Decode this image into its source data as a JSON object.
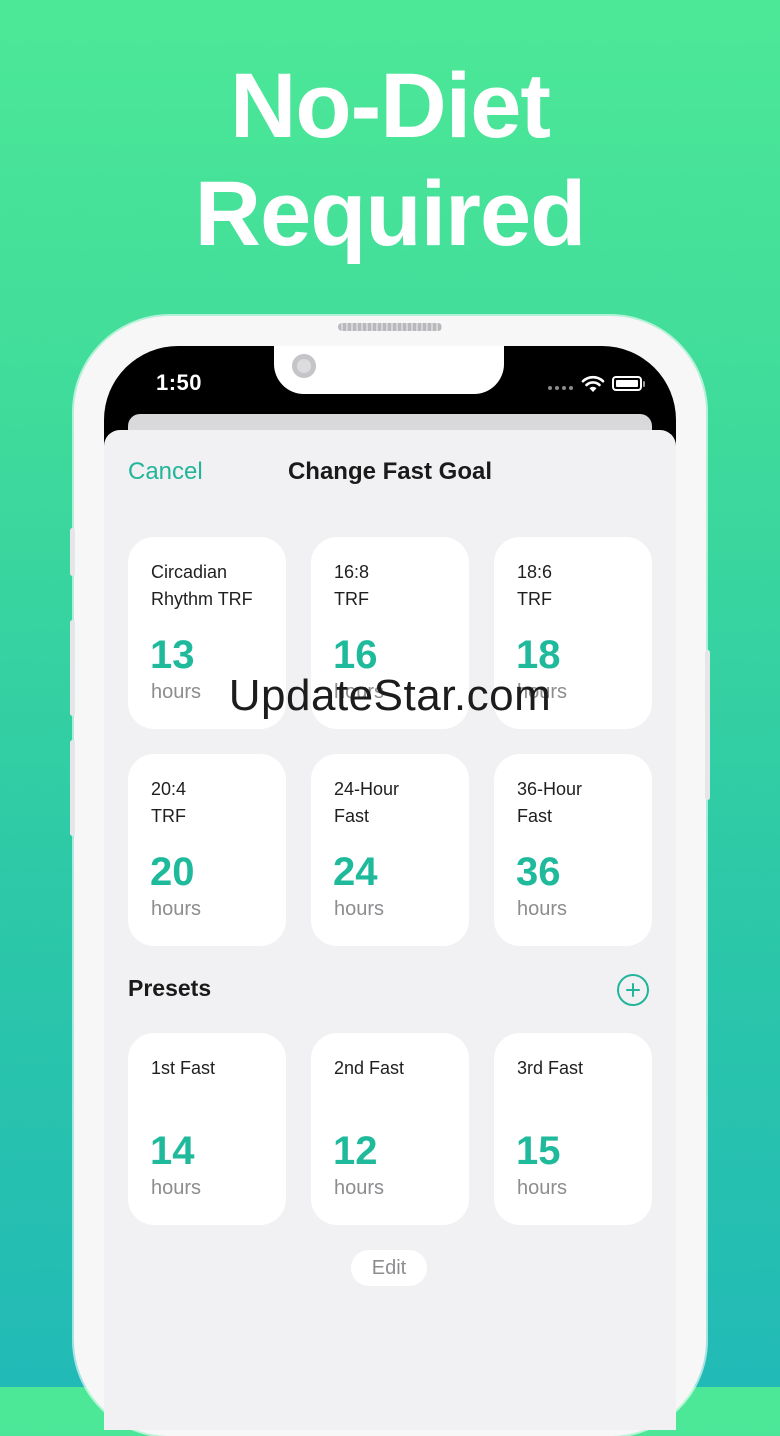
{
  "headline": {
    "line1": "No-Diet",
    "line2": "Required"
  },
  "status_bar": {
    "time": "1:50"
  },
  "header": {
    "cancel_label": "Cancel",
    "title": "Change Fast Goal"
  },
  "goals": [
    {
      "name": "Circadian Rhythm TRF",
      "hours": "13",
      "unit": "hours"
    },
    {
      "name": "16:8 TRF",
      "hours": "16",
      "unit": "hours"
    },
    {
      "name": "18:6 TRF",
      "hours": "18",
      "unit": "hours"
    },
    {
      "name": "20:4 TRF",
      "hours": "20",
      "unit": "hours"
    },
    {
      "name": "24-Hour Fast",
      "hours": "24",
      "unit": "hours"
    },
    {
      "name": "36-Hour Fast",
      "hours": "36",
      "unit": "hours"
    }
  ],
  "presets": {
    "label": "Presets",
    "items": [
      {
        "name": "1st Fast",
        "hours": "14",
        "unit": "hours"
      },
      {
        "name": "2nd Fast",
        "hours": "12",
        "unit": "hours"
      },
      {
        "name": "3rd Fast",
        "hours": "15",
        "unit": "hours"
      }
    ],
    "edit_label": "Edit"
  },
  "watermark": "UpdateStar.com",
  "colors": {
    "accent": "#1fba9b",
    "background_top": "#4de897",
    "background_bottom": "#22bab6"
  },
  "icons": {
    "add": "plus-circle-icon",
    "wifi": "wifi-icon",
    "battery": "battery-icon",
    "signal": "cellular-dots-icon"
  }
}
